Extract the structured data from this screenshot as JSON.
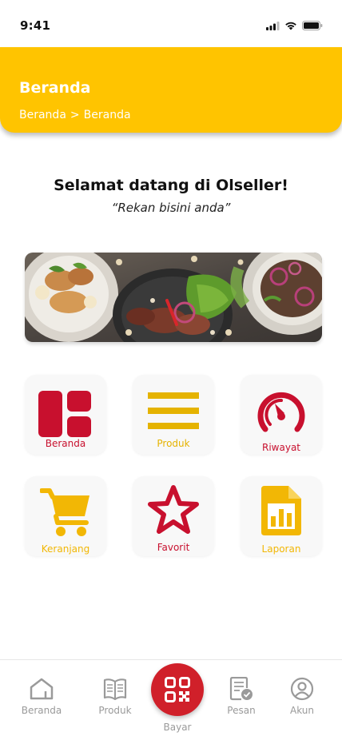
{
  "status_bar": {
    "time": "9:41"
  },
  "header": {
    "title": "Beranda",
    "breadcrumb": [
      "Beranda",
      ">",
      "Beranda"
    ],
    "color": "#FFC400"
  },
  "welcome": {
    "title": "Selamat datang di Olseller!",
    "tagline": "“Rekan bisini anda”"
  },
  "menu": {
    "items": [
      {
        "label": "Beranda",
        "icon": "dashboard-icon",
        "color": "#C8102E"
      },
      {
        "label": "Produk",
        "icon": "list-icon",
        "color": "#E5B300"
      },
      {
        "label": "Riwayat",
        "icon": "gauge-icon",
        "color": "#C8102E"
      },
      {
        "label": "Keranjang",
        "icon": "cart-icon",
        "color": "#F2B705"
      },
      {
        "label": "Favorit",
        "icon": "star-icon",
        "color": "#C8102E"
      },
      {
        "label": "Laporan",
        "icon": "report-icon",
        "color": "#F2B705"
      }
    ]
  },
  "bottom_nav": {
    "items": [
      {
        "label": "Beranda",
        "icon": "home-icon"
      },
      {
        "label": "Produk",
        "icon": "book-icon"
      },
      {
        "label": "Bayar",
        "icon": "qr-code-icon"
      },
      {
        "label": "Pesan",
        "icon": "order-icon"
      },
      {
        "label": "Akun",
        "icon": "account-icon"
      }
    ],
    "accent": "#D0202A"
  }
}
